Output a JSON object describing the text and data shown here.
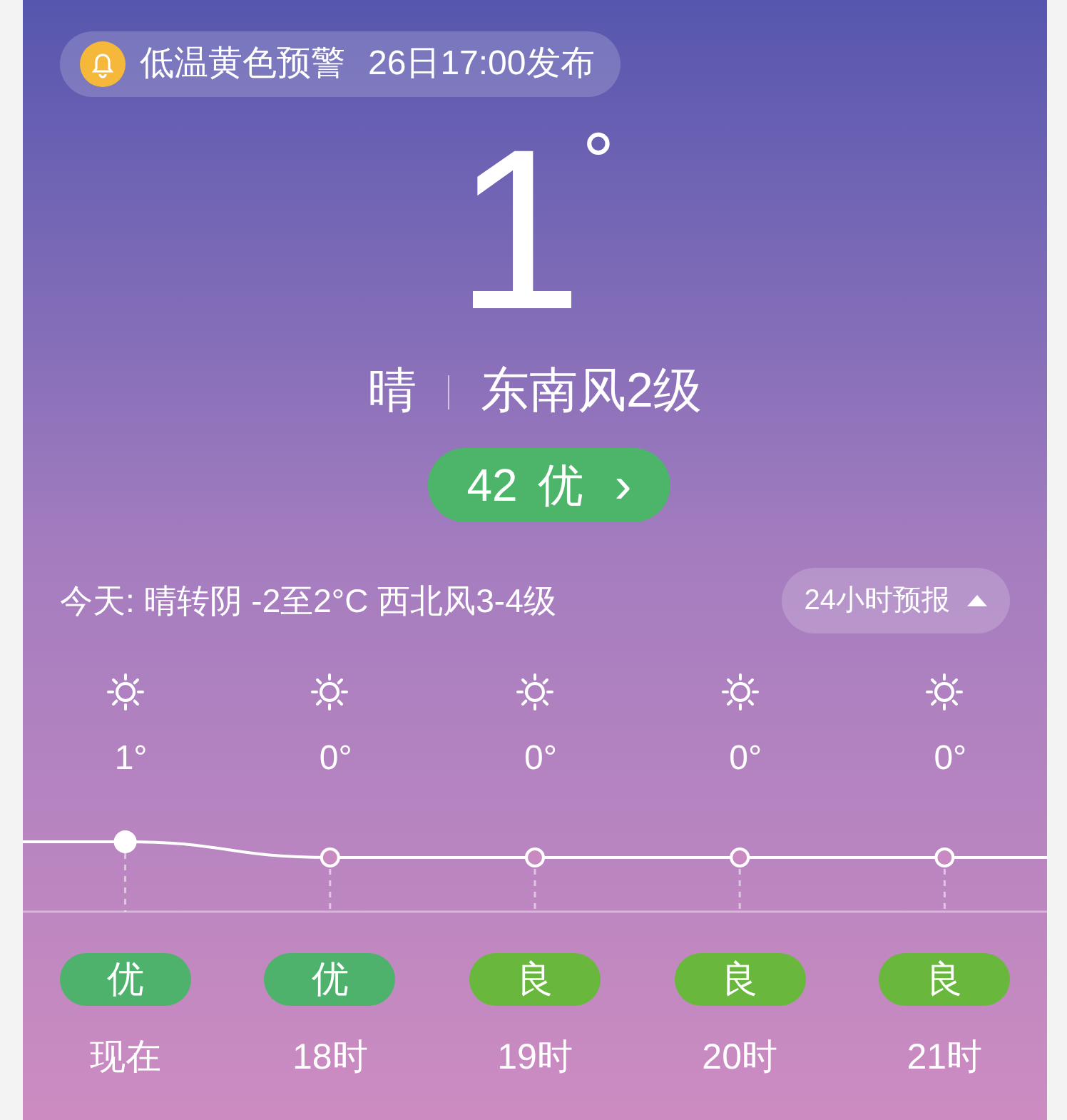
{
  "alert": {
    "title": "低温黄色预警",
    "time": "26日17:00发布"
  },
  "current": {
    "temperature": "1",
    "degree": "°",
    "condition": "晴",
    "wind": "东南风2级"
  },
  "aqi": {
    "value": "42",
    "level": "优",
    "arrow": "›"
  },
  "today": {
    "label": "今天:",
    "condition": "晴转阴",
    "range": "-2至2°C",
    "wind": "西北风3-4级"
  },
  "forecast_button": {
    "label": "24小时预报",
    "expanded": true
  },
  "hours": [
    {
      "temperature": "1°",
      "aqi": "优",
      "color": "#4fb26c",
      "time": "现在",
      "current": true
    },
    {
      "temperature": "0°",
      "aqi": "优",
      "color": "#4fb26c",
      "time": "18时",
      "current": false
    },
    {
      "temperature": "0°",
      "aqi": "良",
      "color": "#69b83d",
      "time": "19时",
      "current": false
    },
    {
      "temperature": "0°",
      "aqi": "良",
      "color": "#69b83d",
      "time": "20时",
      "current": false
    },
    {
      "temperature": "0°",
      "aqi": "良",
      "color": "#69b83d",
      "time": "21时",
      "current": false
    }
  ]
}
